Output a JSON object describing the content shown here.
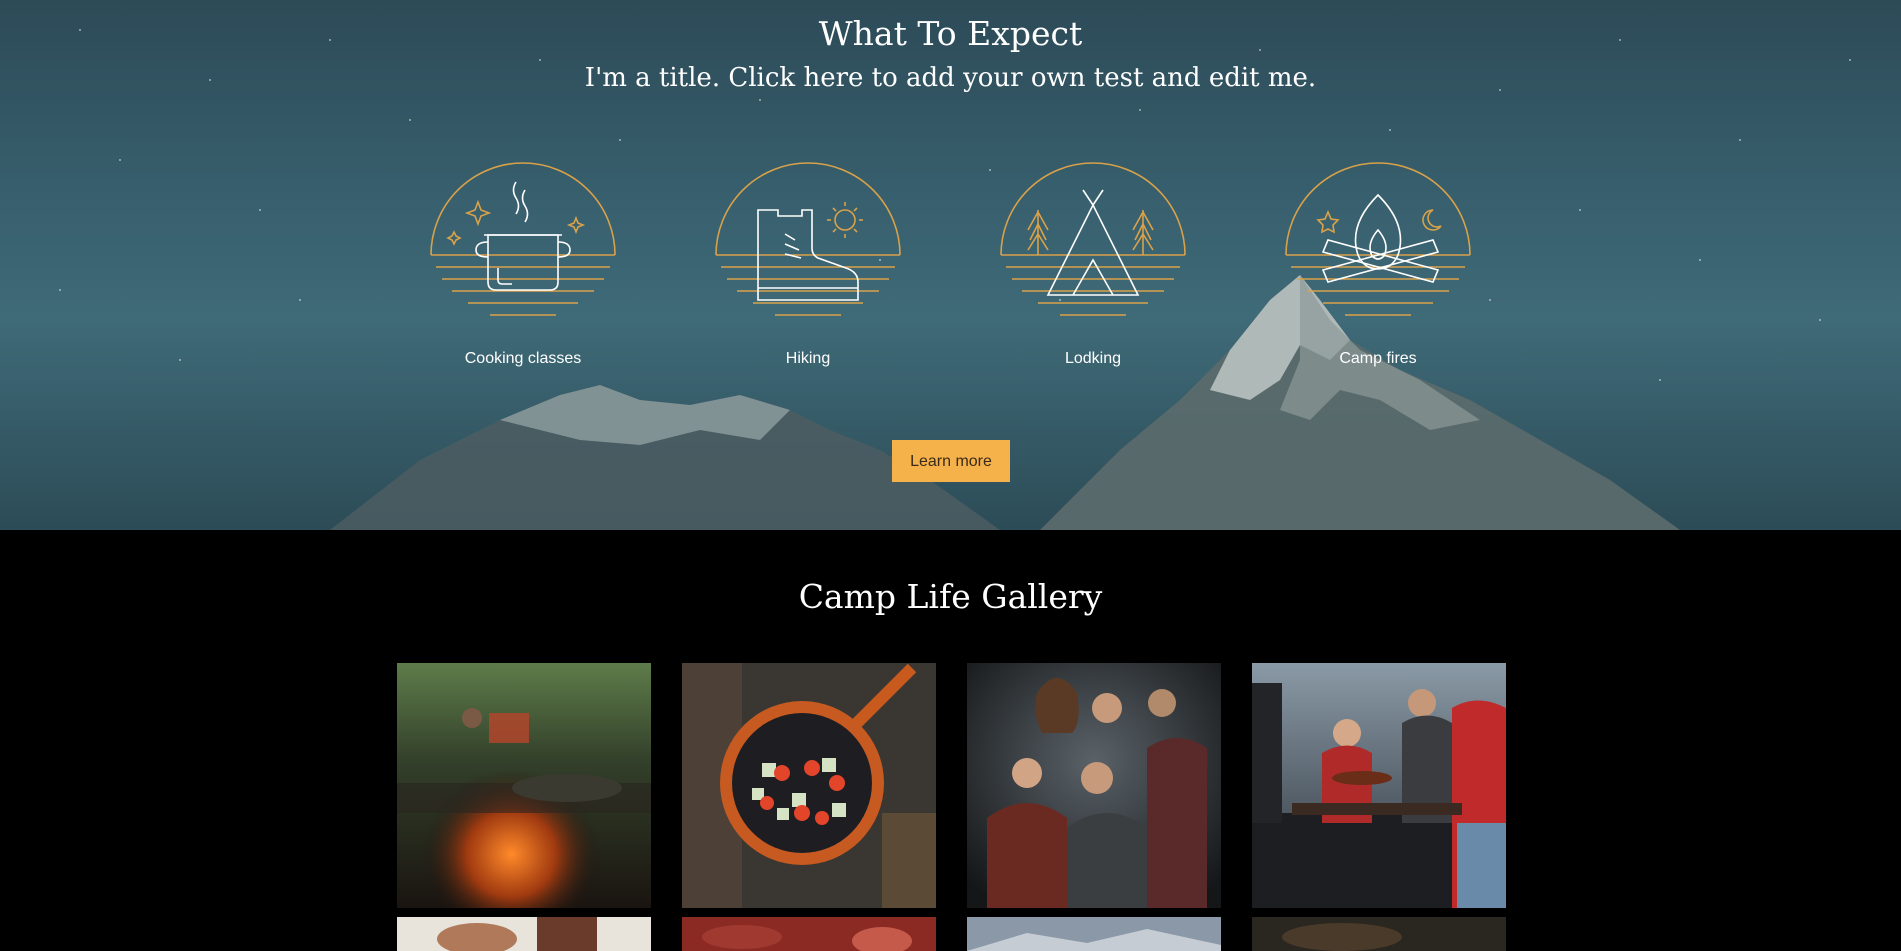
{
  "hero": {
    "title": "What To Expect",
    "subtitle": "I'm a title. Click here to add your own test and edit me.",
    "features": [
      {
        "label": "Cooking classes",
        "icon": "cooking-pot-icon"
      },
      {
        "label": "Hiking",
        "icon": "hiking-boot-icon"
      },
      {
        "label": "Lodking",
        "icon": "tent-icon"
      },
      {
        "label": "Camp fires",
        "icon": "campfire-icon"
      }
    ],
    "button_label": "Learn more"
  },
  "gallery": {
    "title": "Camp Life Gallery",
    "photos": [
      {
        "subject": "campfire-grill-photo"
      },
      {
        "subject": "skillet-vegetables-photo"
      },
      {
        "subject": "friends-around-fire-photo"
      },
      {
        "subject": "barbecue-grill-photo"
      },
      {
        "subject": "hands-photo"
      },
      {
        "subject": "red-food-photo"
      },
      {
        "subject": "mountain-sky-photo"
      },
      {
        "subject": "dark-scene-photo"
      }
    ]
  },
  "colors": {
    "accent": "#f5b24a",
    "icon_line": "#d9a24a",
    "icon_white": "#ffffff",
    "background_dark": "#000000"
  }
}
